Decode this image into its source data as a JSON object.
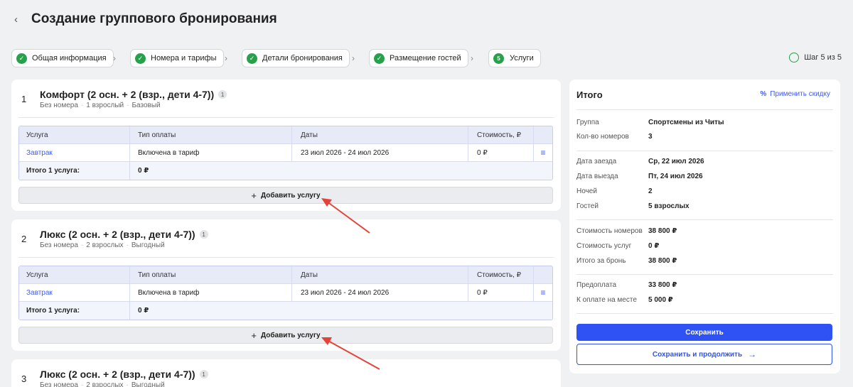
{
  "header": {
    "back_icon": "‹",
    "title": "Создание группового бронирования"
  },
  "steps": [
    {
      "label": "Общая информация",
      "state": "done",
      "icon": "check-icon"
    },
    {
      "label": "Номера и тарифы",
      "state": "done",
      "icon": "check-icon"
    },
    {
      "label": "Детали бронирования",
      "state": "done",
      "icon": "check-icon"
    },
    {
      "label": "Размещение гостей",
      "state": "done",
      "icon": "check-icon"
    },
    {
      "label": "Услуги",
      "state": "current",
      "number": "5"
    }
  ],
  "step_counter": "Шаг 5 из 5",
  "table_headers": {
    "service": "Услуга",
    "payment": "Тип оплаты",
    "dates": "Даты",
    "cost": "Стоимость, ₽"
  },
  "add_service_label": "Добавить услугу",
  "rooms": [
    {
      "number": "1",
      "title": "Комфорт (2 осн. + 2 (взр., дети 4-7))",
      "badge": "1",
      "meta": [
        "Без номера",
        "1 взрослый",
        "Базовый"
      ],
      "services": [
        {
          "name": "Завтрак",
          "payment": "Включена в тариф",
          "dates": "23 июл 2026 - 24 июл 2026",
          "cost": "0 ₽"
        }
      ],
      "total_label": "Итого 1 услуга:",
      "total_value": "0 ₽"
    },
    {
      "number": "2",
      "title": "Люкс (2 осн. + 2 (взр., дети 4-7))",
      "badge": "1",
      "meta": [
        "Без номера",
        "2 взрослых",
        "Выгодный"
      ],
      "services": [
        {
          "name": "Завтрак",
          "payment": "Включена в тариф",
          "dates": "23 июл 2026 - 24 июл 2026",
          "cost": "0 ₽"
        }
      ],
      "total_label": "Итого 1 услуга:",
      "total_value": "0 ₽"
    },
    {
      "number": "3",
      "title": "Люкс (2 осн. + 2 (взр., дети 4-7))",
      "badge": "1",
      "meta": [
        "Без номера",
        "2 взрослых",
        "Выгодный"
      ]
    }
  ],
  "summary": {
    "title": "Итого",
    "discount_label": "Применить скидку",
    "group_label": "Группа",
    "group_value": "Спортсмены из Читы",
    "rooms_label": "Кол-во номеров",
    "rooms_value": "3",
    "checkin_label": "Дата заезда",
    "checkin_value": "Ср, 22 июл 2026",
    "checkout_label": "Дата выезда",
    "checkout_value": "Пт, 24 июл 2026",
    "nights_label": "Ночей",
    "nights_value": "2",
    "guests_label": "Гостей",
    "guests_value": "5 взрослых",
    "room_cost_label": "Стоимость номеров",
    "room_cost_value": "38 800 ₽",
    "svc_cost_label": "Стоимость услуг",
    "svc_cost_value": "0 ₽",
    "total_label": "Итого за бронь",
    "total_value": "38 800 ₽",
    "prepay_label": "Предоплата",
    "prepay_value": "33 800 ₽",
    "onsite_label": "К оплате на месте",
    "onsite_value": "5 000 ₽",
    "save_label": "Сохранить",
    "save_continue_label": "Сохранить и продолжить"
  },
  "colors": {
    "accent": "#2f52f5",
    "success": "#27a24a",
    "annotation": "#e5433a"
  }
}
